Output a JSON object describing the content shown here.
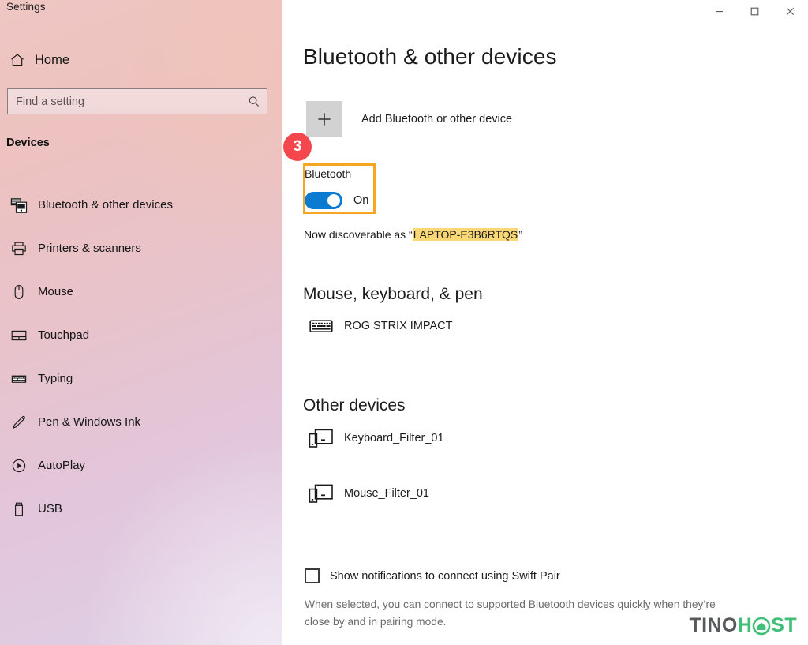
{
  "window": {
    "title": "Settings",
    "controls": [
      {
        "name": "minimize",
        "glyph": "minimize-icon"
      },
      {
        "name": "maximize",
        "glyph": "maximize-icon"
      },
      {
        "name": "close",
        "glyph": "close-icon"
      }
    ]
  },
  "sidebar": {
    "home_label": "Home",
    "home_icon": "home-icon",
    "search": {
      "placeholder": "Find a setting",
      "value": "",
      "icon": "search-icon"
    },
    "section_header": "Devices",
    "items": [
      {
        "label": "Bluetooth & other devices",
        "icon": "bluetooth-devices-icon",
        "selected": true
      },
      {
        "label": "Printers & scanners",
        "icon": "printer-icon",
        "selected": false
      },
      {
        "label": "Mouse",
        "icon": "mouse-icon",
        "selected": false
      },
      {
        "label": "Touchpad",
        "icon": "touchpad-icon",
        "selected": false
      },
      {
        "label": "Typing",
        "icon": "keyboard-icon",
        "selected": false
      },
      {
        "label": "Pen & Windows Ink",
        "icon": "pen-icon",
        "selected": false
      },
      {
        "label": "AutoPlay",
        "icon": "autoplay-icon",
        "selected": false
      },
      {
        "label": "USB",
        "icon": "usb-icon",
        "selected": false
      }
    ]
  },
  "main": {
    "page_title": "Bluetooth & other devices",
    "add_device": {
      "label": "Add Bluetooth or other device",
      "icon": "plus-icon"
    },
    "callout_badge": "3",
    "bluetooth": {
      "label": "Bluetooth",
      "state": "On",
      "toggle_on": true,
      "discoverable_prefix": "Now discoverable as “",
      "discoverable_name": "LAPTOP-E3B6RTQS",
      "discoverable_suffix": "”"
    },
    "sections": [
      {
        "title": "Mouse, keyboard, & pen",
        "devices": [
          {
            "name": "ROG STRIX IMPACT",
            "icon": "keyboard-device-icon"
          }
        ]
      },
      {
        "title": "Other devices",
        "devices": [
          {
            "name": "Keyboard_Filter_01",
            "icon": "generic-device-icon"
          },
          {
            "name": "Mouse_Filter_01",
            "icon": "generic-device-icon"
          }
        ]
      }
    ],
    "swift_pair": {
      "label": "Show notifications to connect using Swift Pair",
      "checked": false,
      "description": "When selected, you can connect to supported Bluetooth devices quickly when they’re close by and in pairing mode."
    }
  },
  "watermark": {
    "part1": "TINO",
    "part2": "H",
    "part3": "ST",
    "icon": "house-in-circle-icon"
  },
  "colors": {
    "accent_blue": "#0b7ad1",
    "highlight_orange": "#f5a623",
    "highlight_yellow": "#fcd775",
    "badge_red": "#f4464d",
    "brand_green": "#3fbf78",
    "brand_gray": "#58595b"
  }
}
